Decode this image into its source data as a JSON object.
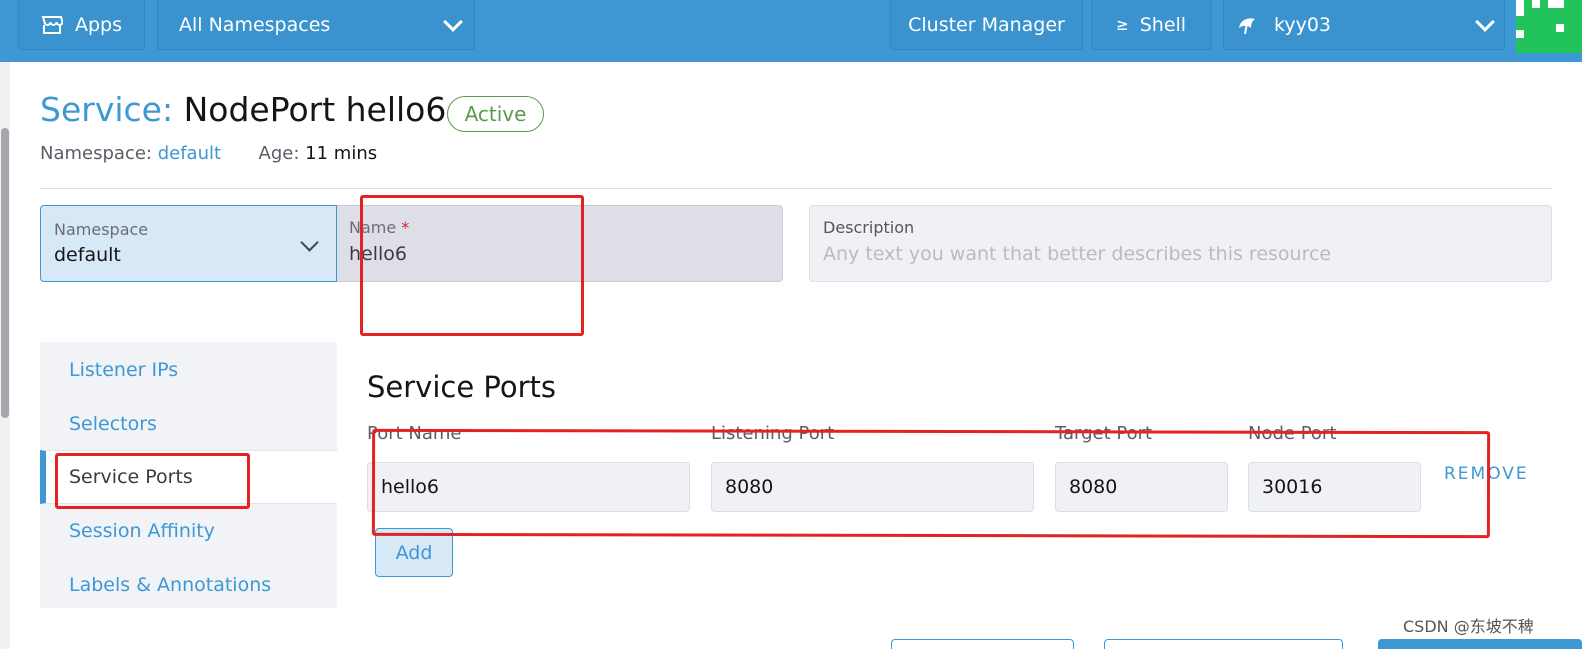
{
  "topbar": {
    "apps_label": "Apps",
    "namespace_filter": "All Namespaces",
    "cluster_manager_label": "Cluster Manager",
    "shell_label": "Shell",
    "shell_icon_glyph": "≥",
    "user_label": "kyy03"
  },
  "header": {
    "kind": "Service:",
    "name": "NodePort hello6",
    "status": "Active",
    "namespace_label": "Namespace:",
    "namespace_value": "default",
    "age_label": "Age:",
    "age_value": "11 mins"
  },
  "form": {
    "namespace_label": "Namespace",
    "namespace_value": "default",
    "name_label": "Name",
    "name_required": "*",
    "name_value": "hello6",
    "description_label": "Description",
    "description_placeholder": "Any text you want that better describes this resource"
  },
  "tabs": [
    {
      "label": "Listener IPs"
    },
    {
      "label": "Selectors"
    },
    {
      "label": "Service Ports"
    },
    {
      "label": "Session Affinity"
    },
    {
      "label": "Labels & Annotations"
    }
  ],
  "service_ports": {
    "title": "Service Ports",
    "headers": {
      "port_name": "Port Name",
      "listening_port": "Listening Port",
      "target_port": "Target Port",
      "node_port": "Node Port"
    },
    "rows": [
      {
        "port_name": "hello6",
        "listening_port": "8080",
        "target_port": "8080",
        "node_port": "30016"
      }
    ],
    "remove_label": "REMOVE",
    "add_label": "Add"
  },
  "watermark": "CSDN @东坡不稗",
  "colors": {
    "accent": "#3d98d3",
    "active_badge": "#5a9a4c",
    "annotation_red": "#e52222"
  }
}
